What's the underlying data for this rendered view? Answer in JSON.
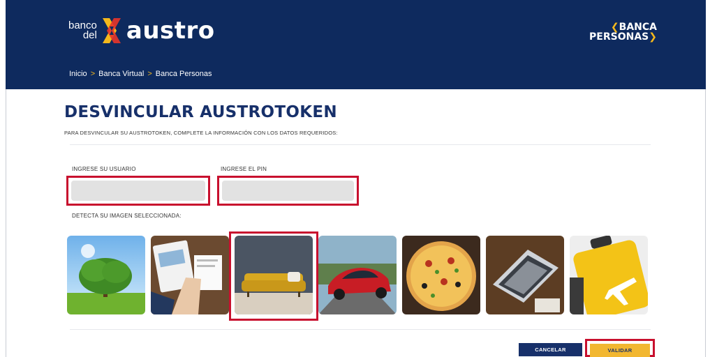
{
  "header": {
    "logo": {
      "line1": "banco",
      "line2": "del",
      "name": "austro"
    },
    "brand": {
      "line1": "BANCA",
      "line2": "PERSONAS"
    },
    "breadcrumb": [
      {
        "label": "Inicio"
      },
      {
        "label": "Banca Virtual"
      },
      {
        "label": "Banca Personas"
      }
    ],
    "breadcrumb_separator": ">"
  },
  "main": {
    "title": "DESVINCULAR AUSTROTOKEN",
    "subtitle": "PARA DESVINCULAR SU AUSTROTOKEN, COMPLETE LA INFORMACIÓN CON LOS DATOS REQUERIDOS:",
    "user_label": "INGRESE SU USUARIO",
    "user_value": "",
    "pin_label": "INGRESE EL PIN",
    "pin_value": "",
    "image_label": "DETECTA SU IMAGEN SELECCIONADA:",
    "images": [
      {
        "name": "tree-image",
        "selected": false
      },
      {
        "name": "business-image",
        "selected": false
      },
      {
        "name": "sofa-image",
        "selected": true
      },
      {
        "name": "car-image",
        "selected": false
      },
      {
        "name": "pizza-image",
        "selected": false
      },
      {
        "name": "laptop-image",
        "selected": false
      },
      {
        "name": "travel-image",
        "selected": false
      }
    ]
  },
  "actions": {
    "cancel_label": "CANCELAR",
    "validate_label": "VALIDAR"
  },
  "colors": {
    "navy": "#0e2a5e",
    "title": "#17306a",
    "accent_yellow": "#f4b81c",
    "highlight_red": "#c8102e",
    "field_gray": "#e2e2e2"
  }
}
